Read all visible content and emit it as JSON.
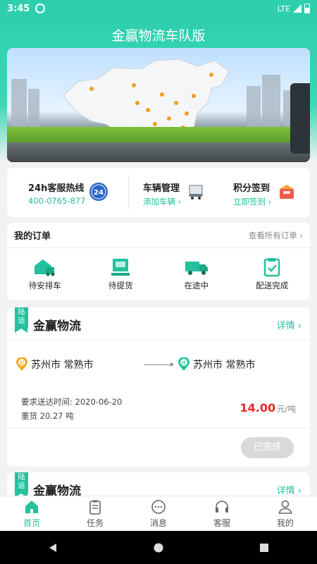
{
  "status": {
    "time": "3:45",
    "network": "LTE"
  },
  "app": {
    "title": "金赢物流车队版"
  },
  "quick_actions": {
    "hotline": {
      "title": "24h客服热线",
      "sub": "400-0765-877",
      "icon_text": "24"
    },
    "vehicle": {
      "title": "车辆管理",
      "sub": "添加车辆 ›"
    },
    "points": {
      "title": "积分签到",
      "sub": "立即签到 ›"
    }
  },
  "my_orders": {
    "title": "我的订单",
    "view_all": "查看所有订单 ›",
    "statuses": [
      {
        "label": "待安排车",
        "icon": "warehouse-truck-icon"
      },
      {
        "label": "待提货",
        "icon": "package-pickup-icon"
      },
      {
        "label": "在途中",
        "icon": "truck-icon"
      },
      {
        "label": "配送完成",
        "icon": "clipboard-check-icon"
      }
    ]
  },
  "order_cards": [
    {
      "tag": "陆运",
      "company": "金赢物流",
      "detail": "详情 ›",
      "from": "苏州市 常熟市",
      "to": "苏州市 常熟市",
      "from_badge": "起",
      "to_badge": "终",
      "deadline": "要求送达时间: 2020-06-20",
      "cargo": "重货  20.27 吨",
      "price": "14.00",
      "price_unit": "元/吨",
      "status": "已完成"
    },
    {
      "tag": "陆运",
      "company": "金赢物流",
      "detail": "详情 ›"
    }
  ],
  "tabbar": [
    {
      "label": "首页",
      "icon": "home-icon",
      "active": true
    },
    {
      "label": "任务",
      "icon": "task-clipboard-icon",
      "active": false
    },
    {
      "label": "消息",
      "icon": "message-icon",
      "active": false
    },
    {
      "label": "客服",
      "icon": "headset-icon",
      "active": false
    },
    {
      "label": "我的",
      "icon": "profile-icon",
      "active": false
    }
  ],
  "colors": {
    "primary": "#23c19d",
    "header": "#2fcfae",
    "price": "#e8262a"
  }
}
